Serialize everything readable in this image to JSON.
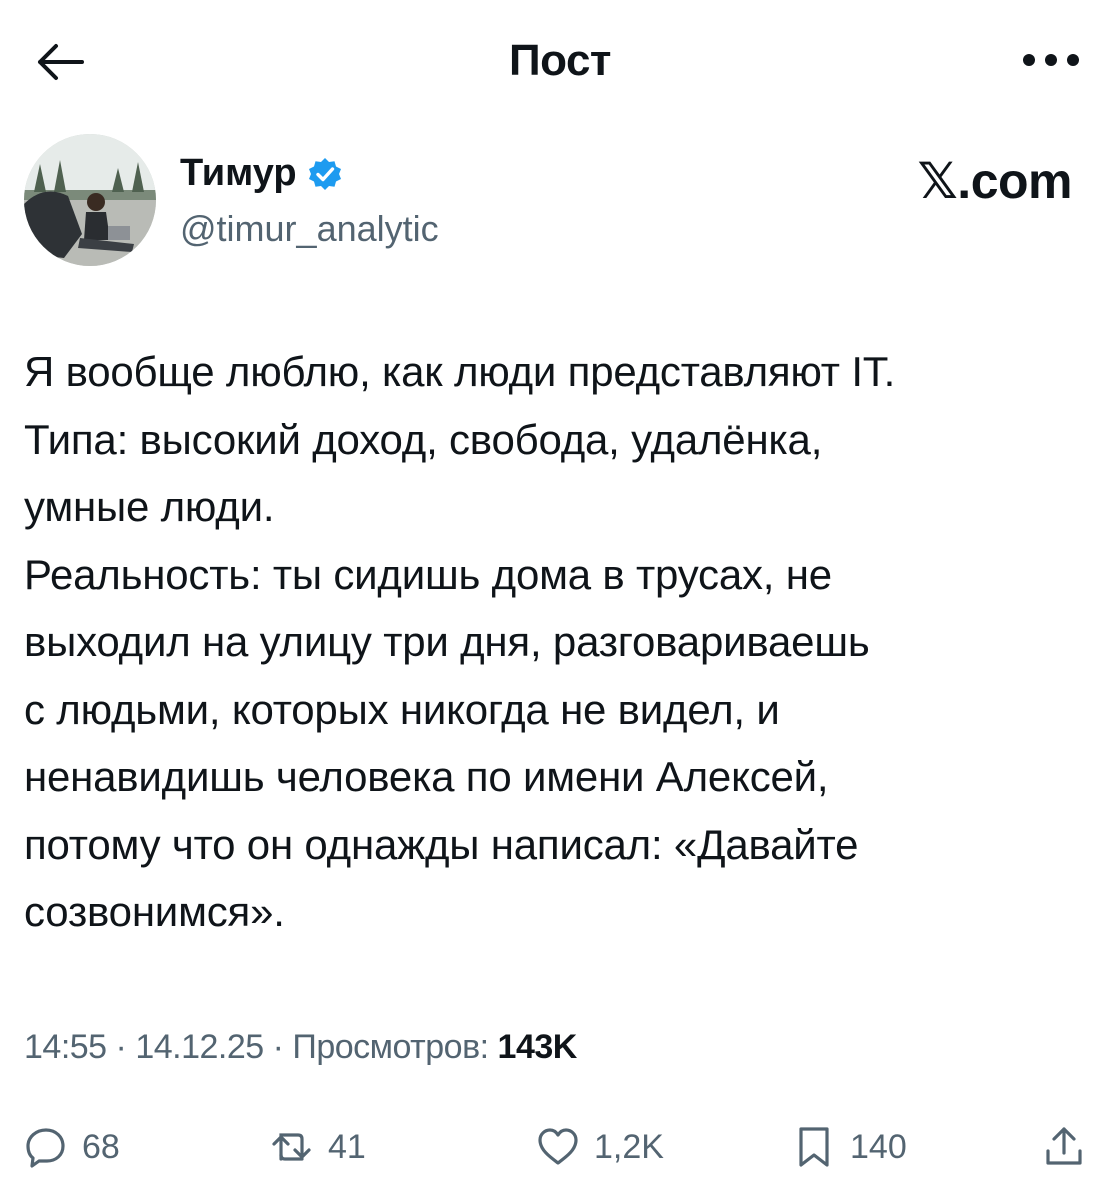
{
  "header": {
    "title": "Пост",
    "back_icon": "arrow-left-icon",
    "more_icon": "more-horizontal-icon"
  },
  "author": {
    "name": "Тимур",
    "handle": "@timur_analytic",
    "verified": true,
    "verified_color": "#1d9bf0",
    "avatar_icon": "avatar-photo"
  },
  "brand": {
    "label": "𝕏.com"
  },
  "post": {
    "text": "Я вообще люблю, как люди представляют IT.\nТипа: высокий доход, свобода, удалёнка,\nумные люди.\nРеальность: ты сидишь дома в трусах, не\nвыходил на улицу три дня, разговариваешь\nс людьми, которых никогда не видел, и\nненавидишь человека по имени Алексей,\nпотому что он однажды написал: «Давайте\nсозвонимся»."
  },
  "meta": {
    "time": "14:55",
    "separator": " · ",
    "date": "14.12.25",
    "views_label": "Просмотров: ",
    "views_count": "143K"
  },
  "actions": {
    "replies": "68",
    "reposts": "41",
    "likes": "1,2K",
    "bookmarks": "140"
  },
  "colors": {
    "text": "#0f1419",
    "secondary": "#536471",
    "accent": "#1d9bf0"
  }
}
